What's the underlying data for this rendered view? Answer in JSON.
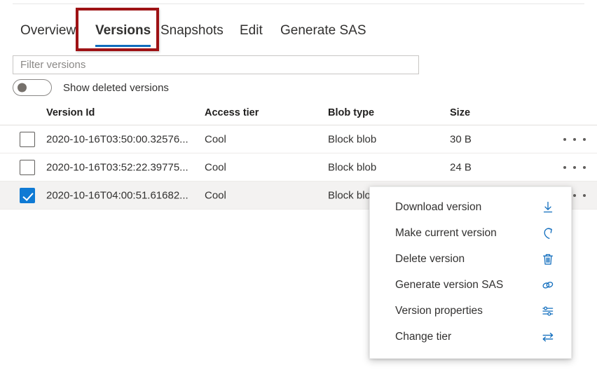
{
  "tabs": [
    {
      "id": "overview",
      "label": "Overview",
      "active": false
    },
    {
      "id": "versions",
      "label": "Versions",
      "active": true
    },
    {
      "id": "snapshots",
      "label": "Snapshots",
      "active": false
    },
    {
      "id": "edit",
      "label": "Edit",
      "active": false
    },
    {
      "id": "generate-sas",
      "label": "Generate SAS",
      "active": false
    }
  ],
  "filter": {
    "placeholder": "Filter versions",
    "value": ""
  },
  "toggle": {
    "label": "Show deleted versions",
    "state": "off"
  },
  "table": {
    "columns": [
      "Version Id",
      "Access tier",
      "Blob type",
      "Size"
    ],
    "rows": [
      {
        "checked": false,
        "version_id": "2020-10-16T03:50:00.32576...",
        "access_tier": "Cool",
        "blob_type": "Block blob",
        "size": "30 B",
        "more": "•••"
      },
      {
        "checked": false,
        "version_id": "2020-10-16T03:52:22.39775...",
        "access_tier": "Cool",
        "blob_type": "Block blob",
        "size": "24 B",
        "more": "•••"
      },
      {
        "checked": true,
        "version_id": "2020-10-16T04:00:51.61682...",
        "access_tier": "Cool",
        "blob_type": "Block blob",
        "size": "",
        "more": "•••"
      }
    ]
  },
  "context_menu": {
    "items": [
      {
        "label": "Download version",
        "icon": "download-icon",
        "highlighted": false
      },
      {
        "label": "Make current version",
        "icon": "redo-arrow-icon",
        "highlighted": true
      },
      {
        "label": "Delete version",
        "icon": "trash-icon",
        "highlighted": false
      },
      {
        "label": "Generate version SAS",
        "icon": "link-chain-icon",
        "highlighted": false
      },
      {
        "label": "Version properties",
        "icon": "sliders-icon",
        "highlighted": false
      },
      {
        "label": "Change tier",
        "icon": "swap-arrows-icon",
        "highlighted": false
      }
    ]
  },
  "annotations": {
    "versions_tab_box": "red-highlight-box",
    "make_current_box": "red-highlight-box"
  },
  "colors": {
    "accent": "#0f6cbd",
    "checkbox": "#0f7ad4",
    "annotation_red": "#9e1215",
    "selected_row": "#f3f2f1",
    "icon_blue": "#0f6cbd"
  }
}
